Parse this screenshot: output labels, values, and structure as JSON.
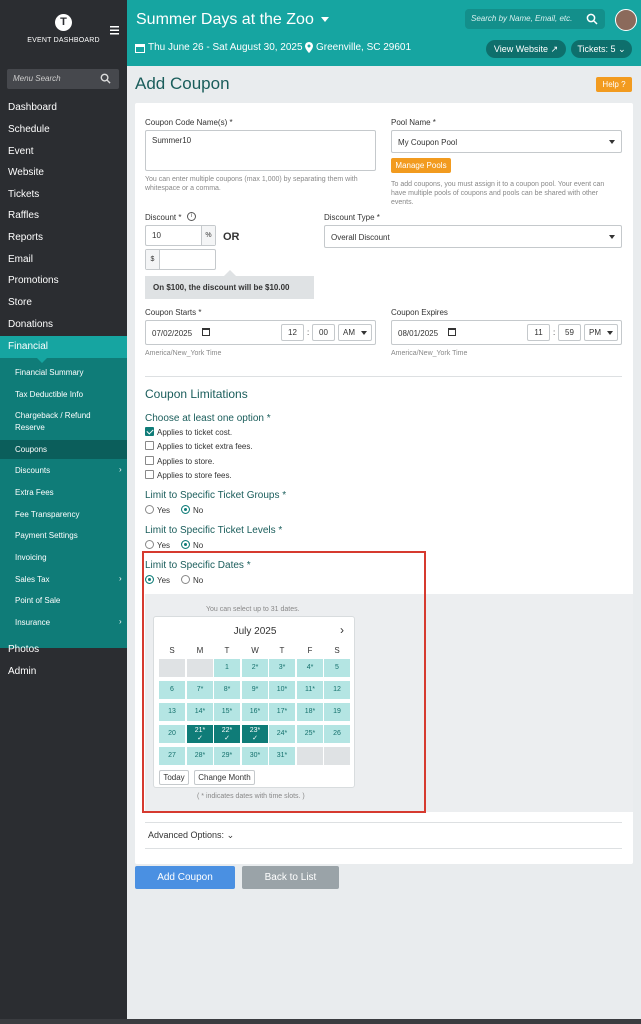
{
  "sidebar": {
    "logo_letter": "T",
    "logo_text": "EVENT DASHBOARD",
    "search_placeholder": "Menu Search",
    "items": [
      "Dashboard",
      "Schedule",
      "Event",
      "Website",
      "Tickets",
      "Raffles",
      "Reports",
      "Email",
      "Promotions",
      "Store",
      "Donations",
      "Financial"
    ],
    "financial_sub": [
      "Financial Summary",
      "Tax Deductible Info",
      "Chargeback / Refund",
      "Reserve",
      "Coupons",
      "Discounts",
      "Extra Fees",
      "Fee Transparency",
      "Payment Settings",
      "Invoicing",
      "Sales Tax",
      "Point of Sale",
      "Insurance"
    ],
    "bottom_items": [
      "Photos",
      "Admin"
    ]
  },
  "header": {
    "title": "Summer Days at the Zoo",
    "dates": "Thu June 26 - Sat August 30, 2025",
    "location": "Greenville, SC 29601",
    "search_placeholder": "Search by Name, Email, etc.",
    "view_website": "View Website",
    "tickets": "Tickets: 5"
  },
  "page": {
    "title": "Add Coupon",
    "help": "Help"
  },
  "form": {
    "code_label": "Coupon Code Name(s) *",
    "code_value": "Summer10",
    "code_help_1": "You can enter multiple coupons (max 1,000) by separating them with",
    "code_help_2": "whitespace or a comma.",
    "pool_label": "Pool Name *",
    "pool_value": "My Coupon Pool",
    "manage_pools": "Manage Pools",
    "pool_help_1": "To add coupons, you must assign it to a coupon pool. Your event can",
    "pool_help_2": "have multiple pools of coupons and pools can be shared with other",
    "pool_help_3": "events.",
    "discount_label": "Discount *",
    "discount_value": "10",
    "percent": "%",
    "or": "OR",
    "dollar": "$",
    "discount_note": "On $100, the discount will be $10.00",
    "discount_type_label": "Discount Type *",
    "discount_type_value": "Overall Discount",
    "starts_label": "Coupon Starts *",
    "starts_date": "07/02/2025",
    "starts_hour": "12",
    "starts_min": "00",
    "starts_ampm": "AM",
    "expires_label": "Coupon Expires",
    "expires_date": "08/01/2025",
    "expires_hour": "11",
    "expires_min": "59",
    "expires_ampm": "PM",
    "timezone": "America/New_York Time",
    "limitations_heading": "Coupon Limitations",
    "choose_label": "Choose at least one option *",
    "options": [
      "Applies to ticket cost.",
      "Applies to ticket extra fees.",
      "Applies to store.",
      "Applies to store fees."
    ],
    "ticket_groups_label": "Limit to Specific Ticket Groups *",
    "ticket_levels_label": "Limit to Specific Ticket Levels *",
    "dates_label": "Limit to Specific Dates *",
    "yes": "Yes",
    "no": "No",
    "select_note": "You can select up to 31 dates.",
    "asterisk_note": "( * indicates dates with time slots. )",
    "advanced": "Advanced Options:",
    "add_button": "Add Coupon",
    "back_button": "Back to List"
  },
  "calendar": {
    "month": "July 2025",
    "weekdays": [
      "S",
      "M",
      "T",
      "W",
      "T",
      "F",
      "S"
    ],
    "today": "Today",
    "change_month": "Change Month",
    "days": [
      "1",
      "2*",
      "3*",
      "4*",
      "5",
      "6",
      "7*",
      "8*",
      "9*",
      "10*",
      "11*",
      "12",
      "13",
      "14*",
      "15*",
      "16*",
      "17*",
      "18*",
      "19",
      "20",
      "21*",
      "22*",
      "23*",
      "24*",
      "25*",
      "26",
      "27",
      "28*",
      "29*",
      "30*",
      "31*"
    ],
    "selected": [
      "21*",
      "22*",
      "23*"
    ]
  },
  "colors": {
    "teal": "#16a5a1",
    "dark_teal": "#0f7c78",
    "orange": "#f29b1f",
    "blue": "#4a90e2",
    "red": "#d63a2f"
  }
}
